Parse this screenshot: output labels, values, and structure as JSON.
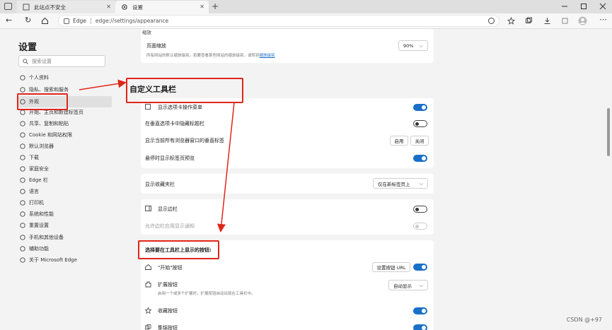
{
  "browser": {
    "tab1_title": "此站点不安全",
    "tab2_title": "设置",
    "new_tab": "+",
    "address_label": "Edge",
    "url": "edge://settings/appearance"
  },
  "sidebar": {
    "title": "设置",
    "search_placeholder": "搜索设置",
    "items": [
      {
        "label": "个人资料",
        "icon": "profile-icon"
      },
      {
        "label": "隐私、搜索和服务",
        "icon": "lock-icon"
      },
      {
        "label": "外观",
        "icon": "appearance-icon"
      },
      {
        "label": "开始、主页和新建标签页",
        "icon": "home-icon"
      },
      {
        "label": "共享、复制和粘贴",
        "icon": "share-icon"
      },
      {
        "label": "Cookie 和网站权限",
        "icon": "cookie-icon"
      },
      {
        "label": "默认浏览器",
        "icon": "browser-icon"
      },
      {
        "label": "下载",
        "icon": "download-icon"
      },
      {
        "label": "家庭安全",
        "icon": "family-icon"
      },
      {
        "label": "Edge 栏",
        "icon": "edge-bar-icon"
      },
      {
        "label": "语言",
        "icon": "language-icon"
      },
      {
        "label": "打印机",
        "icon": "printer-icon"
      },
      {
        "label": "系统和性能",
        "icon": "system-icon"
      },
      {
        "label": "重置设置",
        "icon": "reset-icon"
      },
      {
        "label": "手机和其他设备",
        "icon": "phone-icon"
      },
      {
        "label": "辅助功能",
        "icon": "accessibility-icon"
      },
      {
        "label": "关于 Microsoft Edge",
        "icon": "edge-icon"
      }
    ]
  },
  "zoom": {
    "section_label": "缩放",
    "page_zoom_label": "页面缩放",
    "desc": "所有网站的默认缩放级别。若要查看某些网站的缩放级别，请转到",
    "desc_link": "缩放级别",
    "value": "90%"
  },
  "toolbar": {
    "heading": "自定义工具栏",
    "show_tab_actions_menu": "显示选项卡操作菜单",
    "hide_title_bar_vertical": "在垂直选项卡中隐藏标题栏",
    "show_vertical_tabs_all_windows": "显示当前所有浏览器窗口的垂直标签",
    "enable_btn": "启用",
    "disable_btn": "关闭",
    "hover_preview": "悬停时显示标签页预览",
    "favorites_bar_label": "显示收藏夹栏",
    "favorites_bar_value": "仅在新标签页上",
    "show_sidebar": "显示边栏",
    "sidebar_notifications": "允许边栏应用显示通知",
    "choose_buttons_heading": "选择要在工具栏上显示的按钮:",
    "home_button": "\"开始\"按钮",
    "set_button_url": "设置按钮 URL",
    "extensions_button": "扩展按钮",
    "extensions_desc": "启用一个或多个扩展时，扩展按钮自动出现在工具栏中。",
    "extensions_value": "自动显示",
    "favorites_button": "收藏按钮",
    "collections_button": "集锦按钮"
  },
  "toggles": {
    "show_tab_actions_menu": true,
    "hide_title_bar_vertical": false,
    "hover_preview": true,
    "show_sidebar": false,
    "sidebar_notifications": false,
    "home_button": true,
    "favorites_button": true,
    "collections_button": true
  },
  "accent_color": "#1a6fc9",
  "annotation_color": "#e0261b",
  "watermark": "CSDN @+97"
}
